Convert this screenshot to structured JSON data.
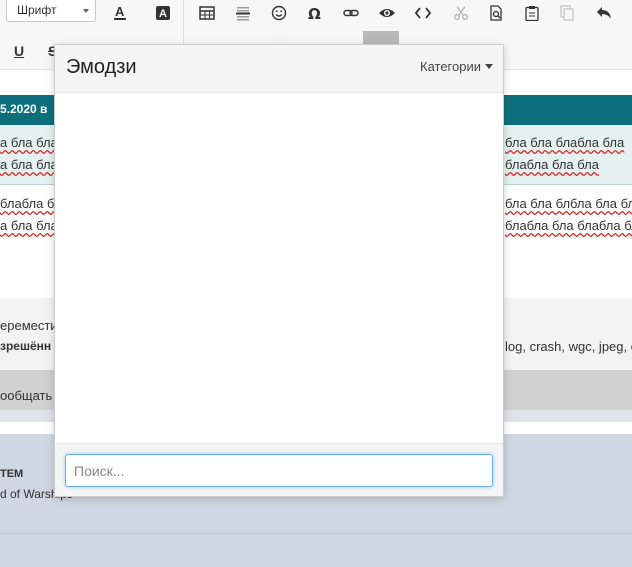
{
  "toolbar": {
    "font_select_label": "Шрифт",
    "underline_label": "U",
    "strike_label": "S"
  },
  "page": {
    "header_date": "5.2020 в",
    "quote_left": [
      "а бла бла",
      "а бла бла"
    ],
    "quote_right": [
      "бла бла блабла бла",
      "блабла бла бла"
    ],
    "body_left": [
      "блабла бла",
      "а бла блаб"
    ],
    "body_right": [
      "бла бла блбла бла бла",
      "блабла бла блабла бла"
    ],
    "move_label": "еремести",
    "allowed_label": "зрешённ",
    "allowed_ext": "log, crash, wgc, jpeg, о",
    "messages_label": "ообщать",
    "footer_heading": "ТЕМ",
    "footer_sub": "d of Warships"
  },
  "emoji_popup": {
    "title": "Эмодзи",
    "categories_label": "Категории",
    "search_placeholder": "Поиск..."
  }
}
